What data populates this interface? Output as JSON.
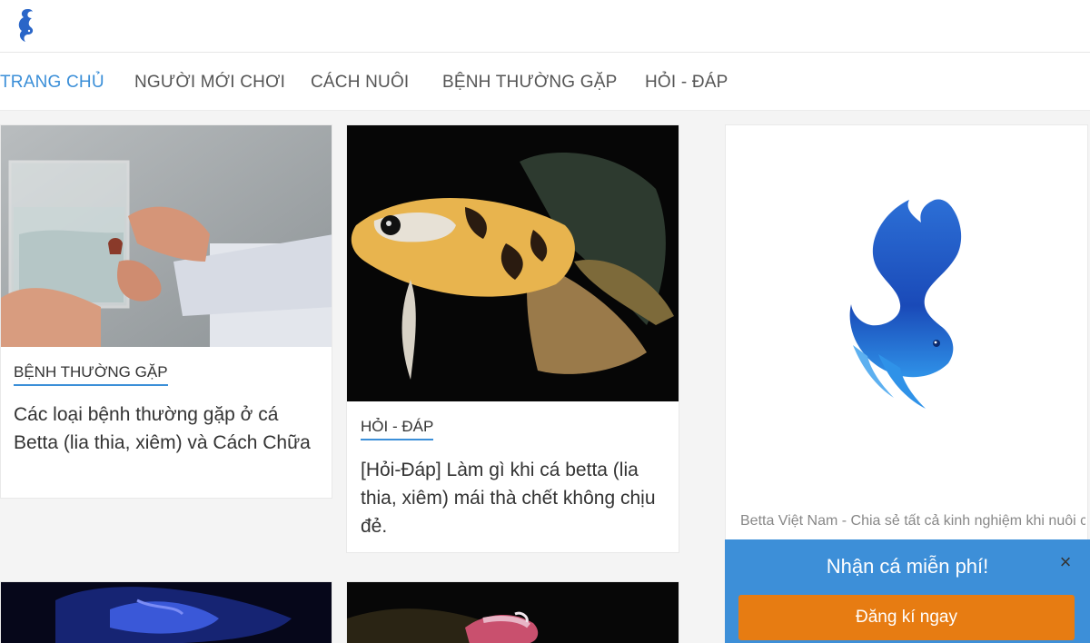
{
  "header": {
    "logo": "betta-fish-logo-icon"
  },
  "nav": {
    "items": [
      {
        "label": "TRANG CHỦ",
        "active": true
      },
      {
        "label": "NGƯỜI MỚI CHƠI",
        "active": false
      },
      {
        "label": "CÁCH NUÔI",
        "active": false
      },
      {
        "label": "BỆNH THƯỜNG GẶP",
        "active": false
      },
      {
        "label": "HỎI - ĐÁP",
        "active": false
      }
    ]
  },
  "posts": [
    {
      "category": "BỆNH THƯỜNG GẶP",
      "title": "Các loại bệnh thường gặp ở cá Betta (lia thia, xiêm) và Cách Chữa",
      "image": "hands-holding-fish-tank-photo"
    },
    {
      "category": "HỎI - ĐÁP",
      "title": "[Hỏi-Đáp] Làm gì khi cá betta (lia thia, xiêm) mái thà chết không chịu đẻ.",
      "image": "koi-betta-fish-photo"
    },
    {
      "image": "blue-betta-fish-photo"
    },
    {
      "image": "red-white-betta-fish-photo"
    }
  ],
  "sidebar": {
    "logo": "betta-vietnam-logo-icon",
    "description": "Betta Việt Nam - Chia sẻ tất cả kinh nghiệm khi nuôi cá betta (xiêm, lia thia)"
  },
  "popup": {
    "title": "Nhận cá miễn phí!",
    "close": "×",
    "button": "Đăng kí ngay"
  },
  "colors": {
    "accent": "#3b8fd8",
    "popup_bg": "#3d8fd8",
    "cta": "#e77c12"
  }
}
